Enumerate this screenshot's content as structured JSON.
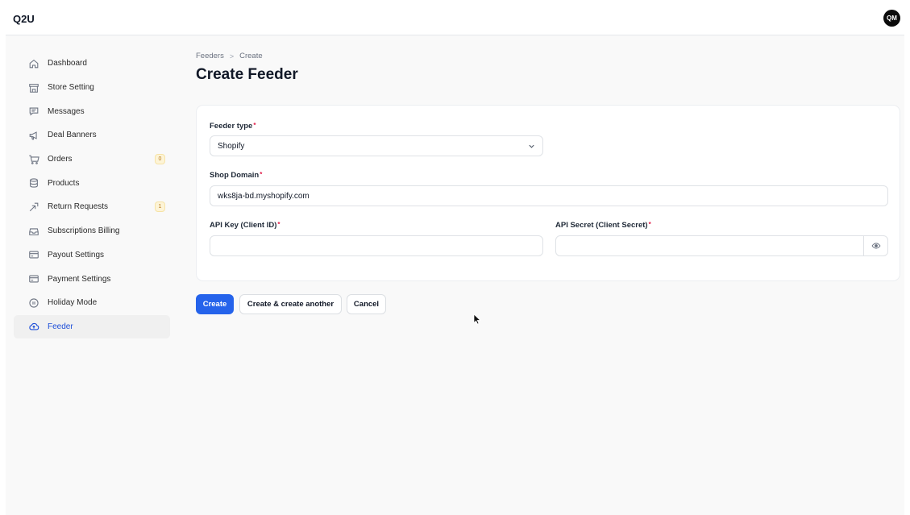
{
  "app": {
    "brand": "Q2U",
    "avatar_initials": "QM"
  },
  "sidebar": {
    "items": [
      {
        "label": "Dashboard",
        "icon": "home-icon"
      },
      {
        "label": "Store Setting",
        "icon": "store-icon"
      },
      {
        "label": "Messages",
        "icon": "chat-icon"
      },
      {
        "label": "Deal Banners",
        "icon": "megaphone-icon"
      },
      {
        "label": "Orders",
        "icon": "cart-icon",
        "badge": "0"
      },
      {
        "label": "Products",
        "icon": "database-icon"
      },
      {
        "label": "Return Requests",
        "icon": "return-arrow-icon",
        "badge": "1"
      },
      {
        "label": "Subscriptions Billing",
        "icon": "inbox-icon"
      },
      {
        "label": "Payout Settings",
        "icon": "credit-card-icon"
      },
      {
        "label": "Payment Settings",
        "icon": "credit-card-icon"
      },
      {
        "label": "Holiday Mode",
        "icon": "pause-circle-icon"
      },
      {
        "label": "Feeder",
        "icon": "cloud-upload-icon",
        "active": true
      }
    ]
  },
  "breadcrumb": {
    "parent": "Feeders",
    "separator": ">",
    "current": "Create"
  },
  "page": {
    "title": "Create Feeder"
  },
  "form": {
    "feeder_type": {
      "label": "Feeder type",
      "required_mark": "*",
      "value": "Shopify"
    },
    "shop_domain": {
      "label": "Shop Domain",
      "required_mark": "*",
      "value": "wks8ja-bd.myshopify.com"
    },
    "api_key": {
      "label": "API Key (Client ID)",
      "required_mark": "*",
      "value": ""
    },
    "api_secret": {
      "label": "API Secret (Client Secret)",
      "required_mark": "*",
      "value": ""
    }
  },
  "actions": {
    "create": "Create",
    "create_another": "Create & create another",
    "cancel": "Cancel"
  },
  "colors": {
    "primary": "#2563eb",
    "active_nav": "#1d4ed8",
    "required": "#e11d48"
  }
}
